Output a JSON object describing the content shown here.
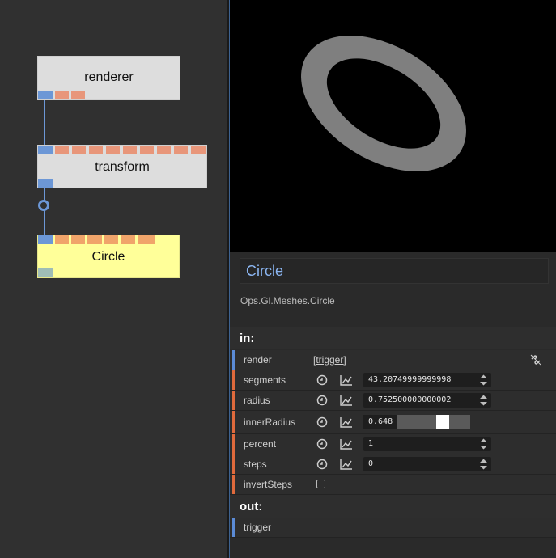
{
  "patch": {
    "ops": [
      {
        "id": "renderer",
        "label": "renderer"
      },
      {
        "id": "transform",
        "label": "transform"
      },
      {
        "id": "circle",
        "label": "Circle"
      }
    ]
  },
  "colors": {
    "port_trigger": "#6c97d6",
    "port_value": "#e8967a",
    "port_number": "#f0a46a",
    "marker_trigger": "#5b8bd6",
    "marker_value": "#e06a3c",
    "title_accent": "#8ab4f0",
    "op_selected": "#ffff99",
    "op_default": "#dddddd",
    "ring": "#7f7f7f"
  },
  "panel": {
    "title": "Circle",
    "path": "Ops.Gl.Meshes.Circle",
    "in_label": "in:",
    "out_label": "out:",
    "inputs": [
      {
        "name": "render",
        "value": "[trigger]",
        "kind": "trigger"
      },
      {
        "name": "segments",
        "value": "43.20749999999998",
        "kind": "number"
      },
      {
        "name": "radius",
        "value": "0.752500000000002",
        "kind": "number"
      },
      {
        "name": "innerRadius",
        "value": "0.648",
        "kind": "slider",
        "level": 0.648
      },
      {
        "name": "percent",
        "value": "1",
        "kind": "number"
      },
      {
        "name": "steps",
        "value": "0",
        "kind": "number"
      },
      {
        "name": "invertSteps",
        "kind": "checkbox",
        "checked": false
      }
    ],
    "outputs": [
      {
        "name": "trigger",
        "kind": "trigger"
      }
    ]
  }
}
